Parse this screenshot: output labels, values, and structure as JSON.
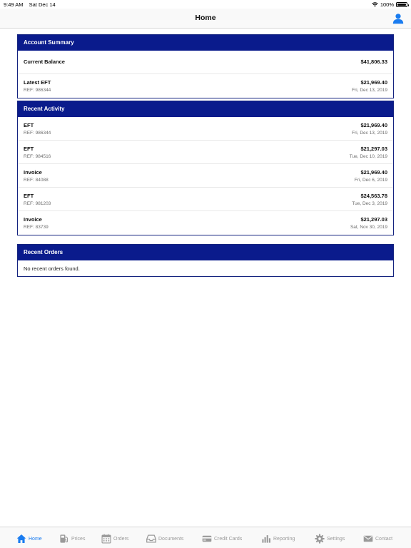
{
  "status_bar": {
    "time": "9:49 AM",
    "date": "Sat Dec 14",
    "battery": "100%"
  },
  "nav": {
    "title": "Home",
    "profile_icon": "person-icon"
  },
  "account_summary": {
    "header": "Account Summary",
    "current_balance_label": "Current Balance",
    "current_balance_value": "$41,806.33",
    "latest_eft_label": "Latest EFT",
    "latest_eft_amount": "$21,969.40",
    "latest_eft_ref": "REF: 986344",
    "latest_eft_date": "Fri, Dec 13, 2019"
  },
  "recent_activity": {
    "header": "Recent Activity",
    "items": [
      {
        "type": "EFT",
        "ref": "REF: 986344",
        "amount": "$21,969.40",
        "date": "Fri, Dec 13, 2019"
      },
      {
        "type": "EFT",
        "ref": "REF: 984516",
        "amount": "$21,297.03",
        "date": "Tue, Dec 10, 2019"
      },
      {
        "type": "Invoice",
        "ref": "REF: 84088",
        "amount": "$21,969.40",
        "date": "Fri, Dec 6, 2019"
      },
      {
        "type": "EFT",
        "ref": "REF: 981203",
        "amount": "$24,563.78",
        "date": "Tue, Dec 3, 2019"
      },
      {
        "type": "Invoice",
        "ref": "REF: 83739",
        "amount": "$21,297.03",
        "date": "Sat, Nov 30, 2019"
      }
    ]
  },
  "recent_orders": {
    "header": "Recent Orders",
    "empty_message": "No recent orders found."
  },
  "tabs": [
    {
      "label": "Home",
      "icon": "home-icon",
      "active": true
    },
    {
      "label": "Prices",
      "icon": "fuel-pump-icon",
      "active": false
    },
    {
      "label": "Orders",
      "icon": "calendar-icon",
      "active": false
    },
    {
      "label": "Documents",
      "icon": "inbox-icon",
      "active": false
    },
    {
      "label": "Credit Cards",
      "icon": "credit-card-icon",
      "active": false
    },
    {
      "label": "Reporting",
      "icon": "bar-chart-icon",
      "active": false
    },
    {
      "label": "Settings",
      "icon": "gear-icon",
      "active": false
    },
    {
      "label": "Contact",
      "icon": "envelope-icon",
      "active": false
    }
  ],
  "colors": {
    "header_blue": "#0a1b8c",
    "active_tab": "#1a7cf0",
    "inactive_tab": "#9a9a9a"
  }
}
